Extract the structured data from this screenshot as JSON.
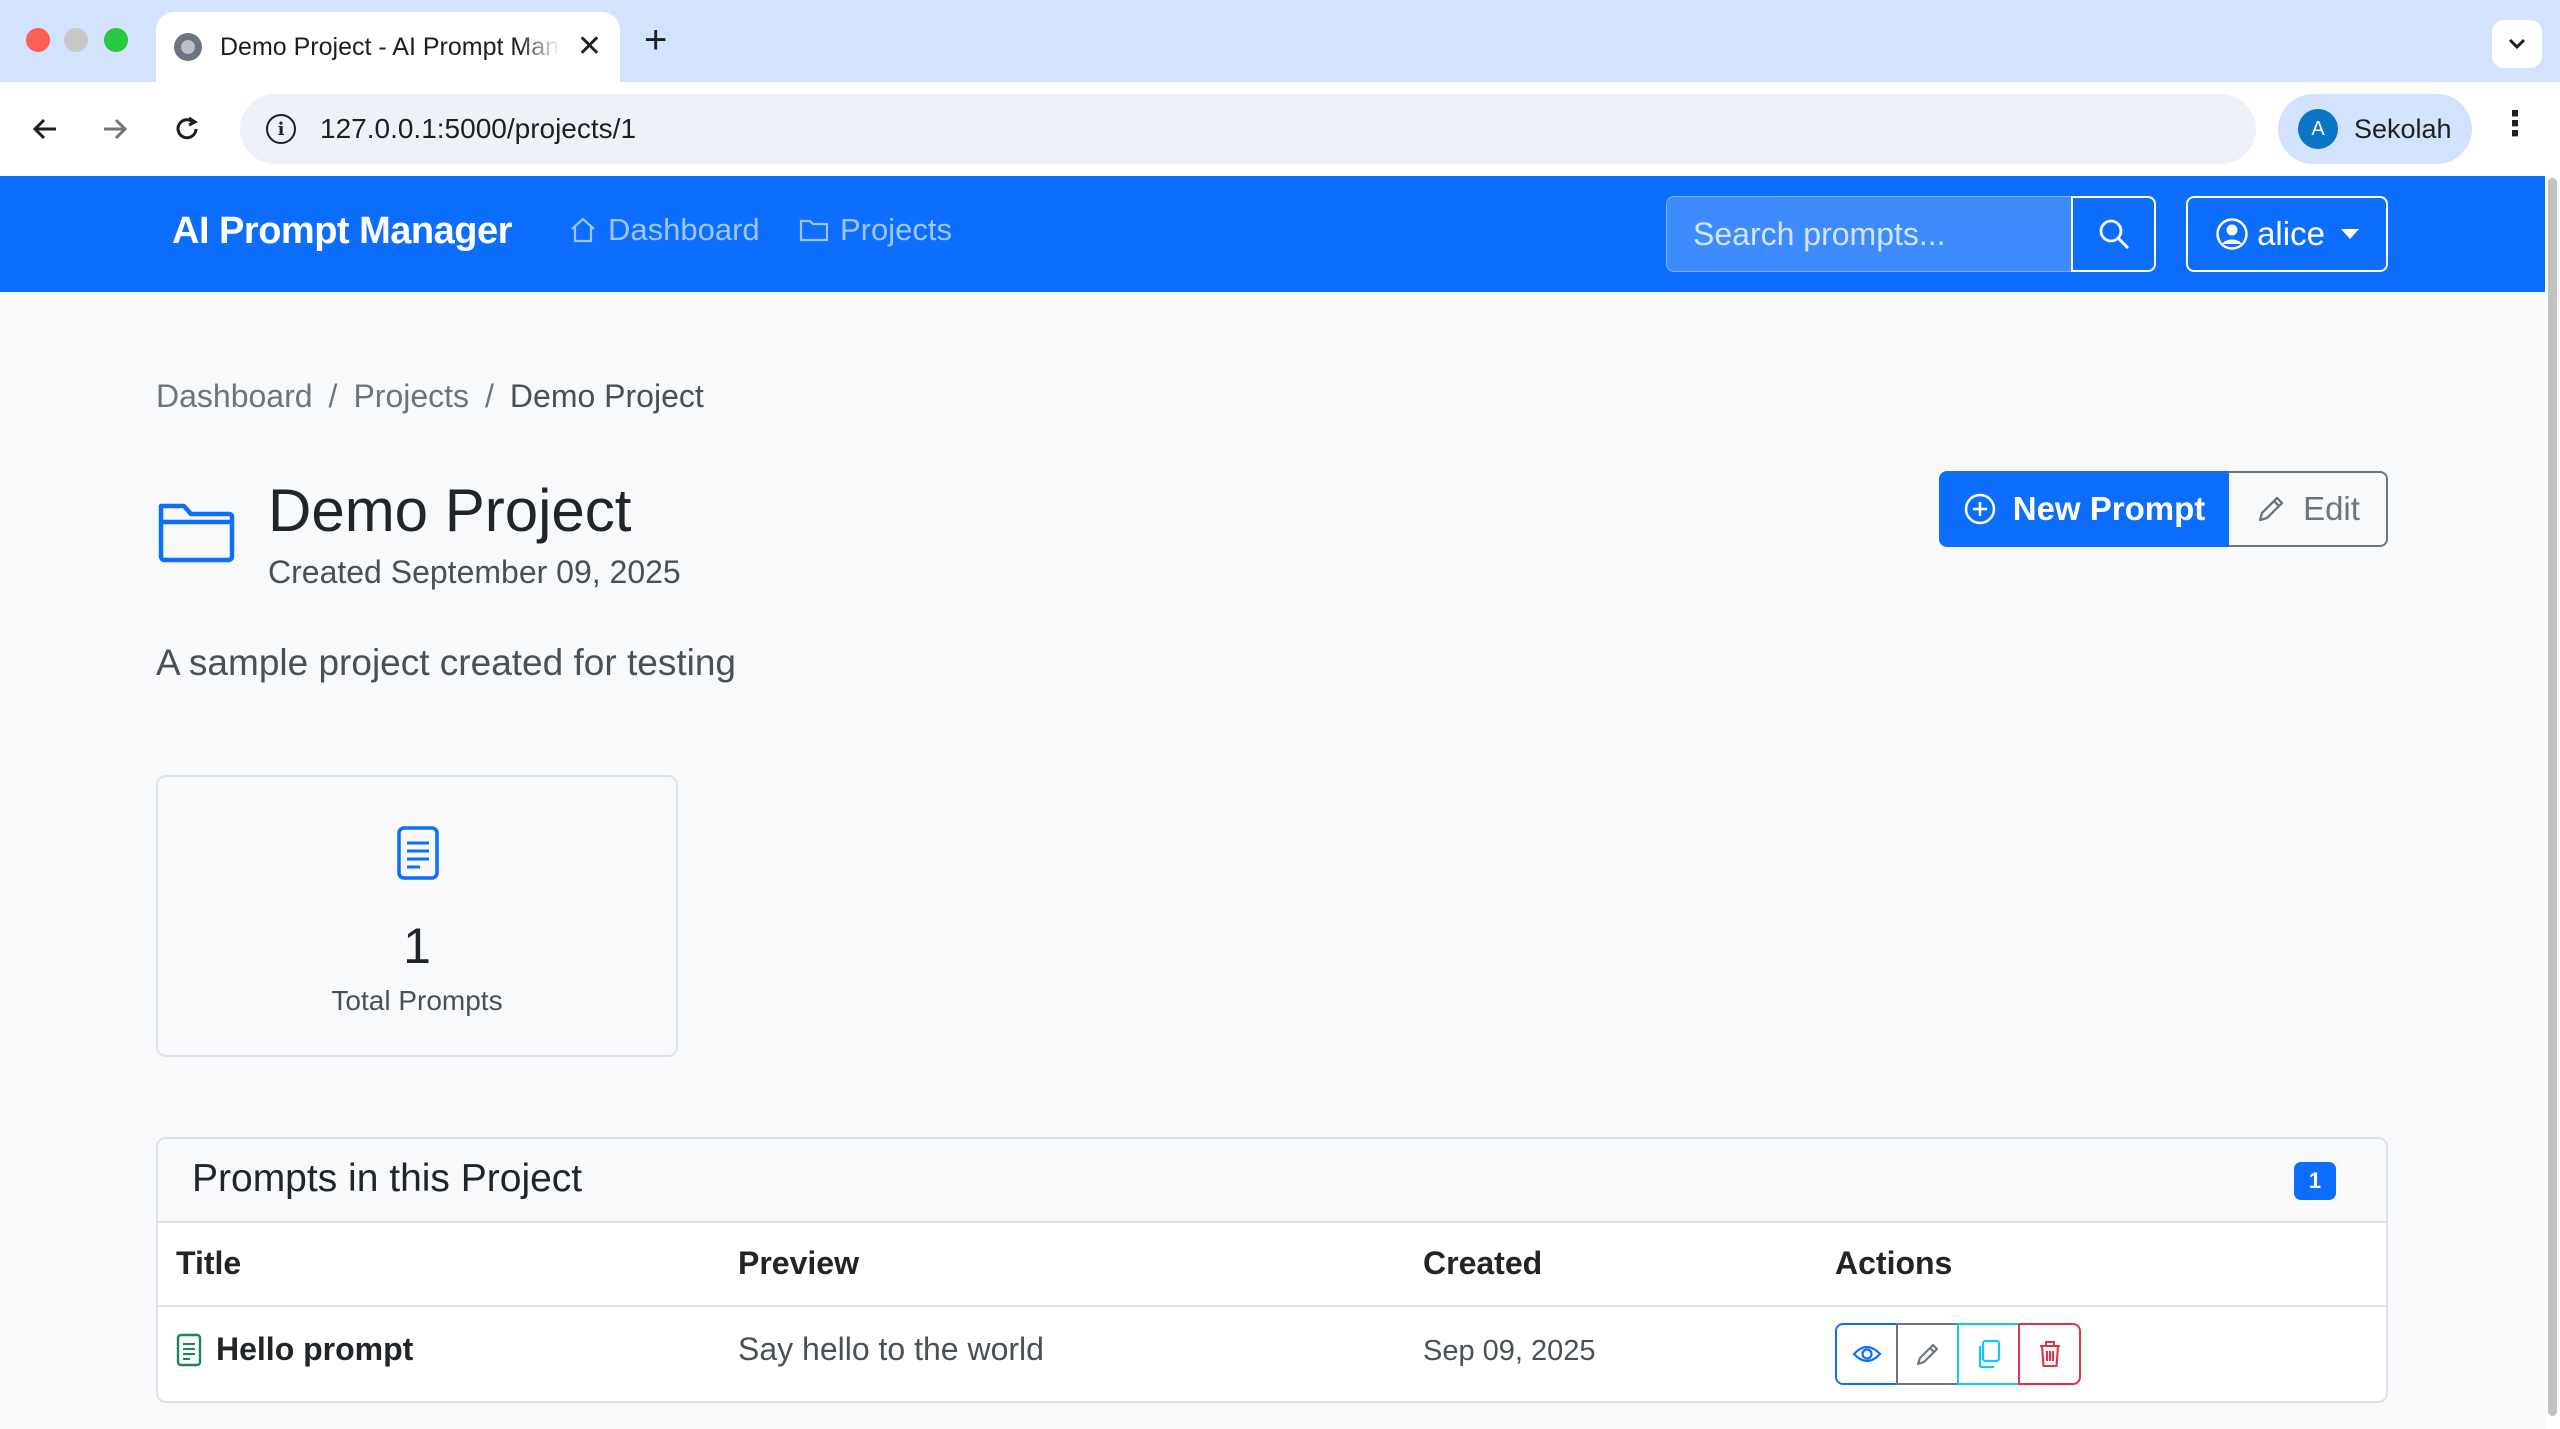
{
  "browser": {
    "tab_title": "Demo Project - AI Prompt Manager",
    "url": "127.0.0.1:5000/projects/1",
    "profile_initial": "A",
    "profile_name": "Sekolah"
  },
  "navbar": {
    "brand": "AI Prompt Manager",
    "links": [
      {
        "label": "Dashboard",
        "icon": "house-icon"
      },
      {
        "label": "Projects",
        "icon": "folder-icon"
      }
    ],
    "search_placeholder": "Search prompts...",
    "user": "alice"
  },
  "breadcrumb": [
    "Dashboard",
    "Projects",
    "Demo Project"
  ],
  "project": {
    "title": "Demo Project",
    "created": "Created September 09, 2025",
    "description": "A sample project created for testing"
  },
  "actions": {
    "new_prompt": "New Prompt",
    "edit": "Edit"
  },
  "stats": {
    "total_prompts": "1",
    "total_prompts_label": "Total Prompts"
  },
  "prompts_card": {
    "title": "Prompts in this Project",
    "count": "1",
    "columns": [
      "Title",
      "Preview",
      "Created",
      "Actions"
    ],
    "rows": [
      {
        "title": "Hello prompt",
        "preview": "Say hello to the world",
        "created": "Sep 09, 2025"
      }
    ]
  },
  "colors": {
    "primary": "#0d6efd",
    "secondary": "#6c757d",
    "info": "#0dcaf0",
    "danger": "#dc3545",
    "success": "#198754"
  }
}
